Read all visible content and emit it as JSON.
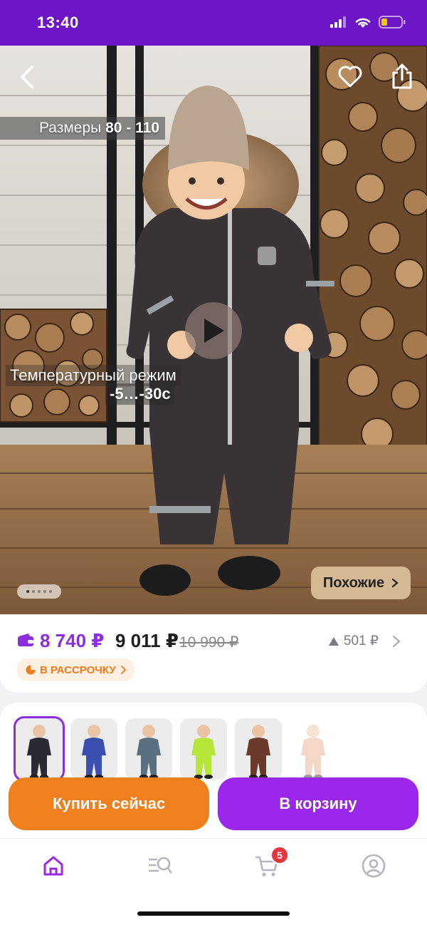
{
  "status_bar": {
    "time": "13:40"
  },
  "hero": {
    "sizes_text": "Размеры ",
    "sizes_value": "80 - 110",
    "temperature_label": "Температурный режим",
    "temperature_value": "-5…-30с",
    "slide_count": 5,
    "active_slide": 1,
    "similar_label": "Похожие"
  },
  "price": {
    "main": "8 740 ₽",
    "secondary": "9 011 ₽",
    "old": "10 990 ₽",
    "points": "501 ₽",
    "installment_label": "В РАССРОЧКУ"
  },
  "variants": {
    "colors": [
      "#2b2a33",
      "#3a4fb0",
      "#5a6f80",
      "#b7e63a",
      "#6b3a2b",
      "#e9a789"
    ],
    "selected_index": 0
  },
  "actions": {
    "buy_now": "Купить сейчас",
    "add_to_cart": "В корзину"
  },
  "nav": {
    "cart_badge": "5",
    "accent": "#9a27ea"
  },
  "colors": {
    "brand_purple": "#6d16c7",
    "price_purple": "#8b2ee0",
    "orange": "#f0801e"
  }
}
